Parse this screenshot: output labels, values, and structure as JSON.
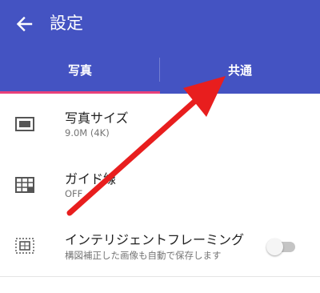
{
  "appbar": {
    "title": "設定",
    "back_icon": "arrow-left-icon",
    "background": "#4453c2"
  },
  "tabs": [
    {
      "label": "写真",
      "selected": true
    },
    {
      "label": "共通",
      "selected": false
    }
  ],
  "colors": {
    "tab_indicator": "#e8407a",
    "annotation_arrow": "#e81e1e"
  },
  "settings": [
    {
      "icon": "picture-size-icon",
      "title": "写真サイズ",
      "subtitle": "9.0M (4K)"
    },
    {
      "icon": "grid-guide-icon",
      "title": "ガイド線",
      "subtitle": "OFF"
    },
    {
      "icon": "framing-icon",
      "title": "インテリジェントフレーミング",
      "subtitle": "構図補正した画像も自動で保存します",
      "toggle_on": false
    }
  ],
  "annotation": {
    "icon": "red-arrow-annotation",
    "points_to": "共通"
  }
}
